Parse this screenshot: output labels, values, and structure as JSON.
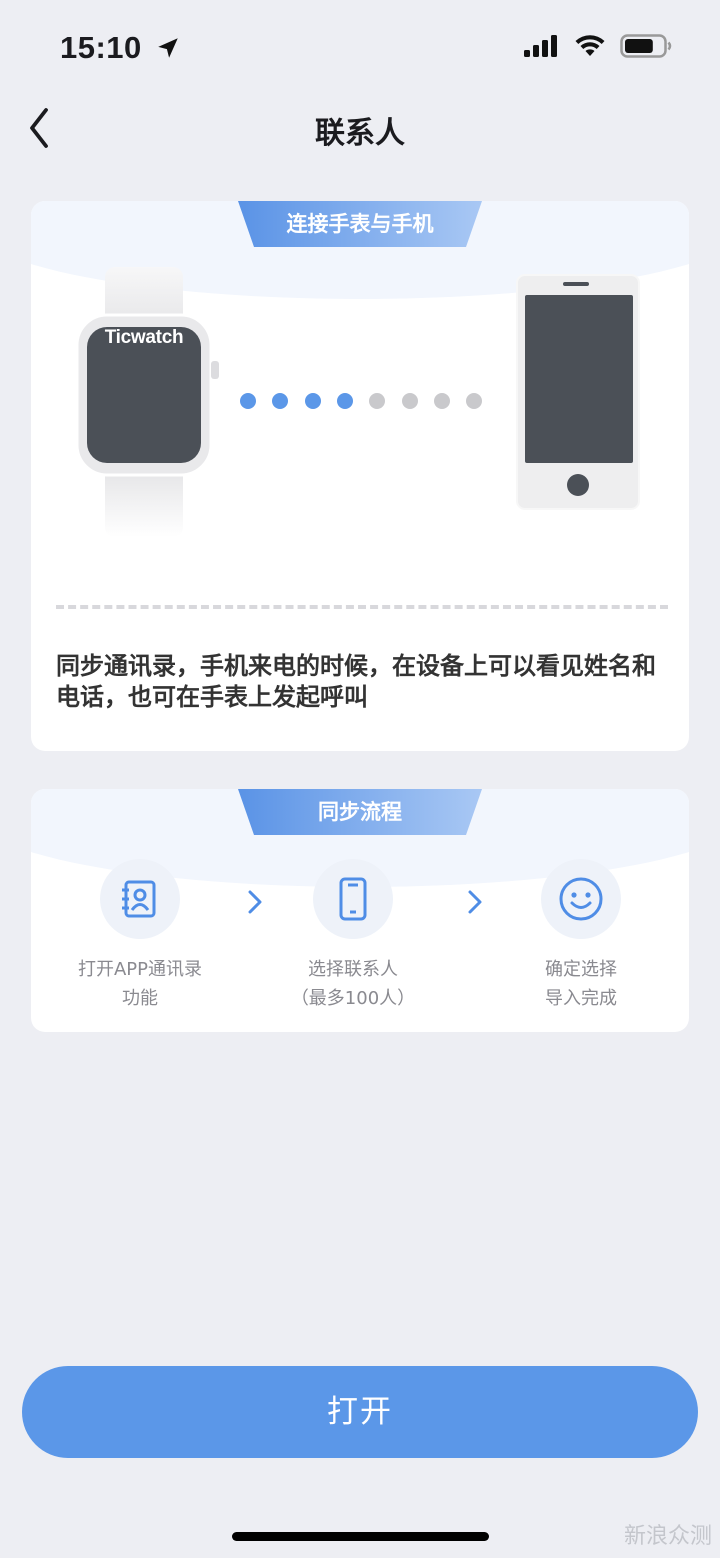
{
  "status_bar": {
    "time": "15:10",
    "battery_level": 0.75
  },
  "nav": {
    "title": "联系人",
    "back_icon": "chevron-left-icon"
  },
  "connect_card": {
    "badge": "连接手表与手机",
    "watch_brand": "Ticwatch",
    "progress_dots_total": 8,
    "progress_dots_active": 4,
    "description": "同步通讯录，手机来电的时候，在设备上可以看见姓名和电话，也可在手表上发起呼叫"
  },
  "sync_card": {
    "badge": "同步流程",
    "steps": [
      {
        "icon": "contact-book-icon",
        "line1": "打开APP通讯录",
        "line2": "功能"
      },
      {
        "icon": "phone-icon",
        "line1": "选择联系人",
        "line2": "（最多100人）"
      },
      {
        "icon": "smiley-icon",
        "line1": "确定选择",
        "line2": "导入完成"
      }
    ]
  },
  "primary_button": {
    "label": "打开"
  },
  "watermark": "新浪众测",
  "colors": {
    "accent": "#5b97e8",
    "dot_active": "#5b97e8",
    "dot_inactive": "#c9c9cc",
    "page_bg": "#edeef3"
  }
}
